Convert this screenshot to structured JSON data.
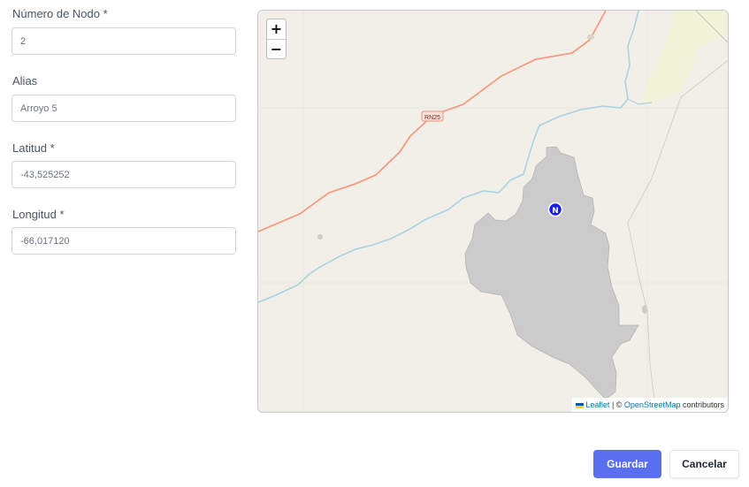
{
  "form": {
    "node_number": {
      "label": "Número de Nodo *",
      "value": "2"
    },
    "alias": {
      "label": "Alias",
      "value": "Arroyo 5"
    },
    "latitude": {
      "label": "Latitud *",
      "value": "-43,525252"
    },
    "longitude": {
      "label": "Longitud *",
      "value": "-66,017120"
    }
  },
  "map": {
    "zoom_in": "+",
    "zoom_out": "−",
    "road_label": "RN25",
    "marker_label": "N",
    "attribution": {
      "leaflet": "Leaflet",
      "separator": " | © ",
      "osm": "OpenStreetMap",
      "suffix": " contributors"
    },
    "colors": {
      "land": "#f2efe9",
      "river": "#aad3df",
      "road": "#f59b82",
      "area": "#cbcbcb",
      "marker": "#1a1aff"
    }
  },
  "actions": {
    "save": "Guardar",
    "cancel": "Cancelar"
  }
}
